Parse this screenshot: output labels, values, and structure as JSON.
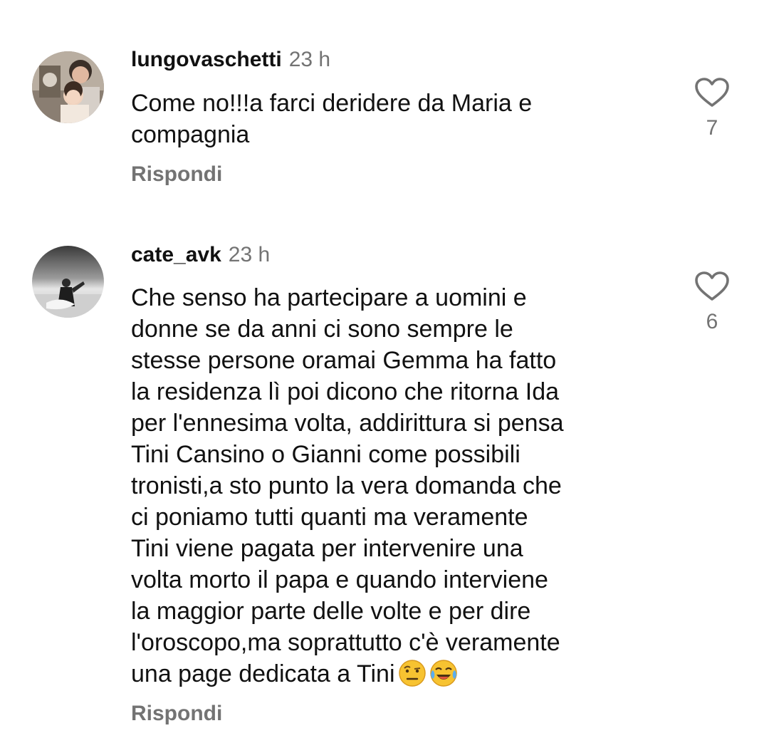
{
  "comments": [
    {
      "avatar_icon": "user-avatar-photo-icon",
      "username": "lungovaschetti",
      "time": "23 h",
      "text": "Come no!!!a farci deridere da Maria e\ncompagnia",
      "like_icon": "heart-outline-icon",
      "like_count": "7",
      "reply_label": "Rispondi"
    },
    {
      "avatar_icon": "user-avatar-photo-icon",
      "username": "cate_avk",
      "time": "23 h",
      "text": "Che senso ha partecipare a uomini e\ndonne se da anni ci sono sempre le\nstesse persone oramai Gemma ha fatto\nla residenza lì poi dicono che ritorna Ida\nper l'ennesima volta, addirittura si pensa\nTini Cansino o Gianni come possibili\ntronisti,a sto punto la vera domanda che\nci poniamo tutti quanti ma veramente\nTini viene pagata per intervenire una\nvolta morto il papa e quando interviene\nla maggior parte delle volte e per dire\nl'oroscopo,ma soprattutto c'è veramente\nuna page dedicata a Tini",
      "emojis": [
        "raised-eyebrow-emoji-icon",
        "tears-of-joy-emoji-icon"
      ],
      "like_icon": "heart-outline-icon",
      "like_count": "6",
      "reply_label": "Rispondi"
    }
  ],
  "colors": {
    "text": "#111111",
    "secondary": "#737373",
    "background": "#ffffff",
    "emoji_yellow": "#f7c331"
  }
}
